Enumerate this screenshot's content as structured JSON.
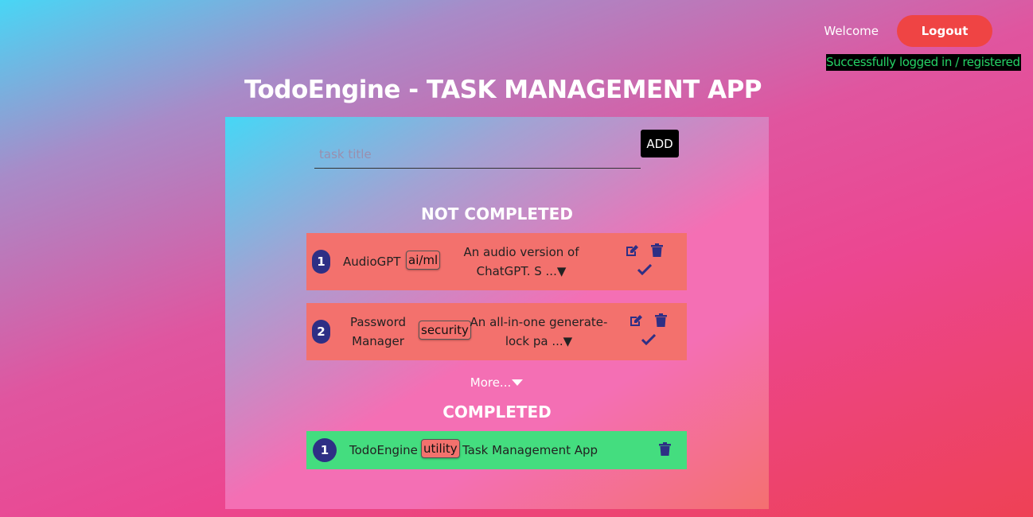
{
  "header": {
    "welcome": "Welcome",
    "logout_label": "Logout",
    "toast": "Successfully logged in / registered."
  },
  "title": "TodoEngine - TASK MANAGEMENT APP",
  "add_form": {
    "placeholder": "task title",
    "add_label": "ADD"
  },
  "not_completed": {
    "heading": "NOT COMPLETED",
    "tasks": [
      {
        "num": "1",
        "name": "AudioGPT",
        "tag": "ai/ml",
        "desc_line1": "An audio version of",
        "desc_line2": "ChatGPT. S ...▼"
      },
      {
        "num": "2",
        "name_line1": "Password",
        "name_line2": "Manager",
        "tag": "security",
        "desc_line1": "An all-in-one generate-",
        "desc_line2": "lock pa ...▼"
      }
    ],
    "more_label": "More..."
  },
  "completed": {
    "heading": "COMPLETED",
    "tasks": [
      {
        "num": "1",
        "name": "TodoEngine",
        "tag": "utility",
        "desc": "Task Management App"
      }
    ]
  },
  "colors": {
    "task_pending": "#f3716d",
    "task_done": "#44dd7f",
    "badge": "#2e2f85",
    "logout": "#ef4444",
    "toast_text": "#25d366"
  },
  "icons": [
    "edit-icon",
    "trash-icon",
    "check-icon",
    "caret-down-icon"
  ]
}
